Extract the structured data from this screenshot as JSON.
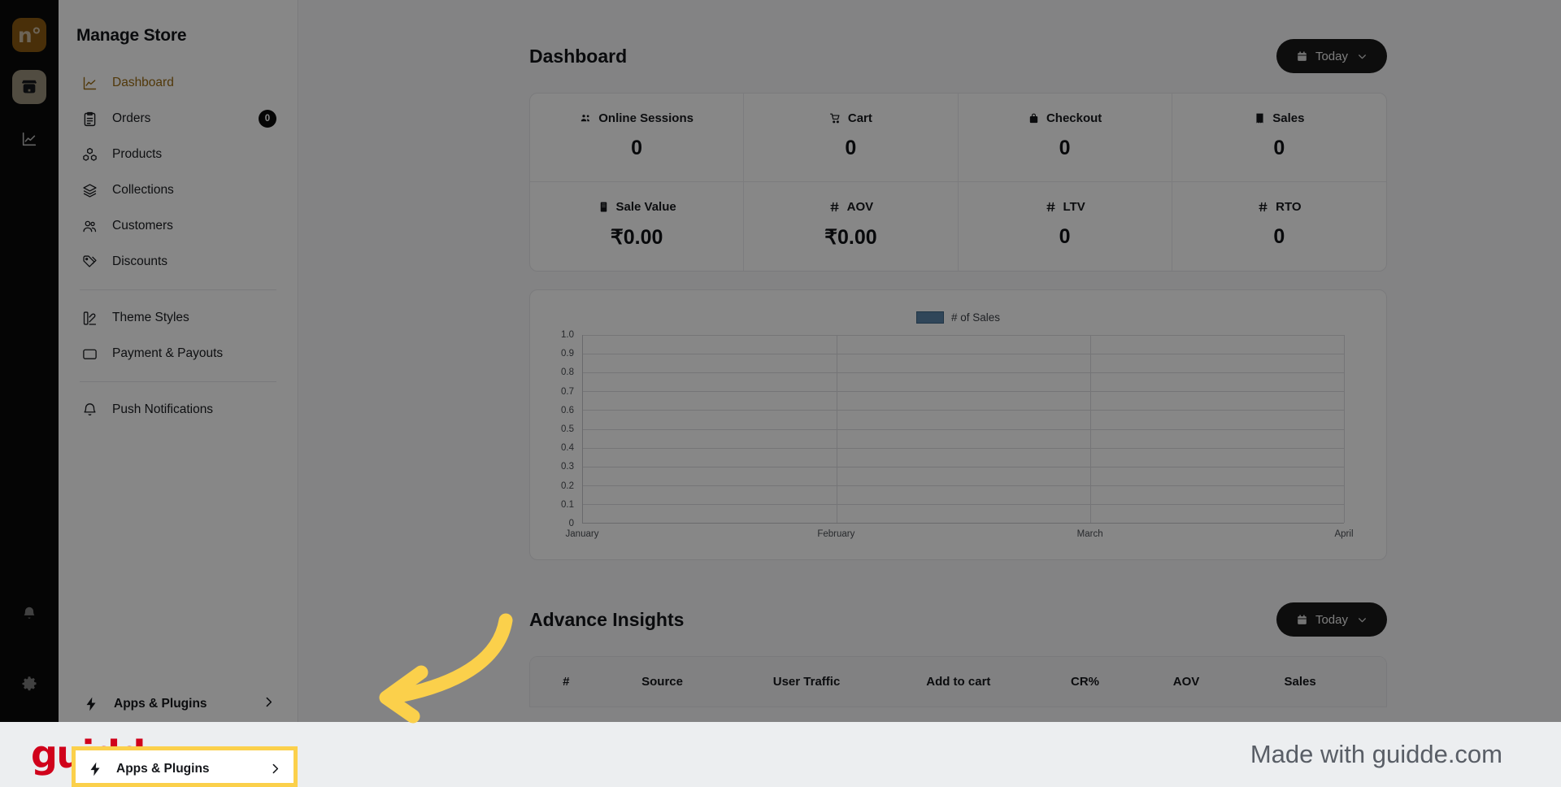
{
  "rail": {
    "logo_glyph": "n°",
    "items": [
      {
        "name": "store-icon",
        "label": "Store"
      },
      {
        "name": "analytics-icon",
        "label": "Analytics"
      }
    ],
    "bottom_items": [
      {
        "name": "bell-icon",
        "label": "Notifications"
      },
      {
        "name": "gear-icon",
        "label": "Settings"
      }
    ]
  },
  "sidebar": {
    "title": "Manage Store",
    "items": [
      {
        "label": "Dashboard",
        "icon": "chart-line-icon",
        "active": true,
        "badge": null
      },
      {
        "label": "Orders",
        "icon": "clipboard-icon",
        "active": false,
        "badge": "0"
      },
      {
        "label": "Products",
        "icon": "boxes-icon",
        "active": false,
        "badge": null
      },
      {
        "label": "Collections",
        "icon": "layers-icon",
        "active": false,
        "badge": null
      },
      {
        "label": "Customers",
        "icon": "users-icon",
        "active": false,
        "badge": null
      },
      {
        "label": "Discounts",
        "icon": "tag-icon",
        "active": false,
        "badge": null
      },
      {
        "label": "Theme Styles",
        "icon": "palette-icon",
        "active": false,
        "badge": null
      },
      {
        "label": "Payment & Payouts",
        "icon": "wallet-icon",
        "active": false,
        "badge": null
      },
      {
        "label": "Push Notifications",
        "icon": "bell-icon",
        "active": false,
        "badge": null
      }
    ],
    "apps_plugins": {
      "label": "Apps & Plugins",
      "icon": "bolt-icon",
      "chevron": "chevron-right-icon"
    }
  },
  "dashboard": {
    "title": "Dashboard",
    "range_button": {
      "label": "Today",
      "icon": "calendar-icon",
      "chevron": "chevron-down-icon"
    },
    "kpis": [
      {
        "label": "Online Sessions",
        "value": "0",
        "icon": "people-icon"
      },
      {
        "label": "Cart",
        "value": "0",
        "icon": "cart-icon"
      },
      {
        "label": "Checkout",
        "value": "0",
        "icon": "bag-icon"
      },
      {
        "label": "Sales",
        "value": "0",
        "icon": "receipt-icon"
      },
      {
        "label": "Sale Value",
        "value": "₹0.00",
        "icon": "bill-icon"
      },
      {
        "label": "AOV",
        "value": "₹0.00",
        "icon": "hash-icon"
      },
      {
        "label": "LTV",
        "value": "0",
        "icon": "hash-icon"
      },
      {
        "label": "RTO",
        "value": "0",
        "icon": "hash-icon"
      }
    ]
  },
  "chart_data": {
    "type": "bar",
    "title": "",
    "legend": [
      "# of Sales"
    ],
    "legend_position": "top-center",
    "legend_color": "#5b84a8",
    "categories": [
      "January",
      "February",
      "March",
      "April"
    ],
    "series": [
      {
        "name": "# of Sales",
        "values": [
          0,
          0,
          0,
          0
        ]
      }
    ],
    "xlabel": "",
    "ylabel": "",
    "ylim": [
      0,
      1.0
    ],
    "yticks": [
      "1.0",
      "0.9",
      "0.8",
      "0.7",
      "0.6",
      "0.5",
      "0.4",
      "0.3",
      "0.2",
      "0.1",
      "0"
    ],
    "grid": true
  },
  "insights": {
    "title": "Advance Insights",
    "range_button": {
      "label": "Today",
      "icon": "calendar-icon",
      "chevron": "chevron-down-icon"
    },
    "columns": [
      "#",
      "Source",
      "User Traffic",
      "Add to cart",
      "CR%",
      "AOV",
      "Sales"
    ],
    "rows": []
  },
  "callout": {
    "target_label": "Apps & Plugins",
    "highlight_color": "#fbd04b",
    "arrow_color": "#fbd04b",
    "arrow_direction": "left"
  },
  "banner": {
    "logo_text": "guidde.",
    "text": "Made with guidde.com",
    "logo_color": "#d0021b"
  }
}
